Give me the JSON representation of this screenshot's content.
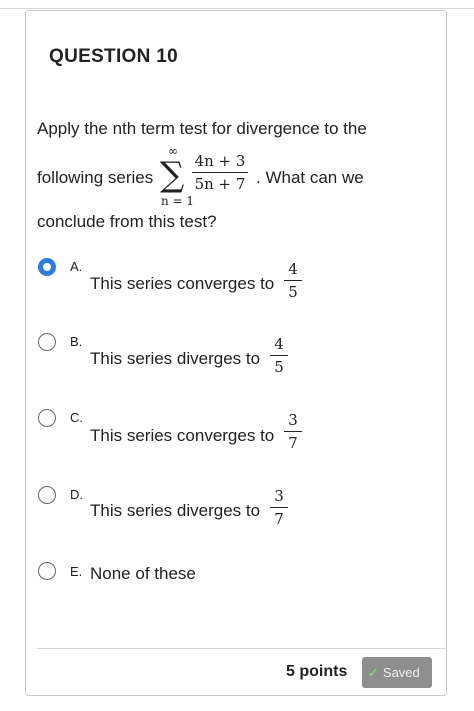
{
  "question": {
    "number_label": "QUESTION 10",
    "line1": "Apply the nth term test for divergence to the",
    "line2_prefix": "following series",
    "line2_suffix": ". What can we",
    "line3": "conclude from this test?",
    "series": {
      "sum_upper": "∞",
      "sum_lower": "n = 1",
      "numerator": "4n + 3",
      "denominator": "5n + 7"
    }
  },
  "options": [
    {
      "letter": "A.",
      "text": "This series converges to",
      "num": "4",
      "den": "5",
      "selected": true
    },
    {
      "letter": "B.",
      "text": "This series diverges to",
      "num": "4",
      "den": "5",
      "selected": false
    },
    {
      "letter": "C.",
      "text": "This series converges to",
      "num": "3",
      "den": "7",
      "selected": false
    },
    {
      "letter": "D.",
      "text": "This series diverges to",
      "num": "3",
      "den": "7",
      "selected": false
    },
    {
      "letter": "E.",
      "text": "None of these",
      "selected": false
    }
  ],
  "footer": {
    "points_label": "5 points",
    "saved_label": "Saved"
  },
  "colors": {
    "selected_radio": "#2e7ae6",
    "saved_button": "#8e8e8e",
    "check_mark": "#8fe08f"
  },
  "icons": {
    "saved_status": "check-icon"
  }
}
